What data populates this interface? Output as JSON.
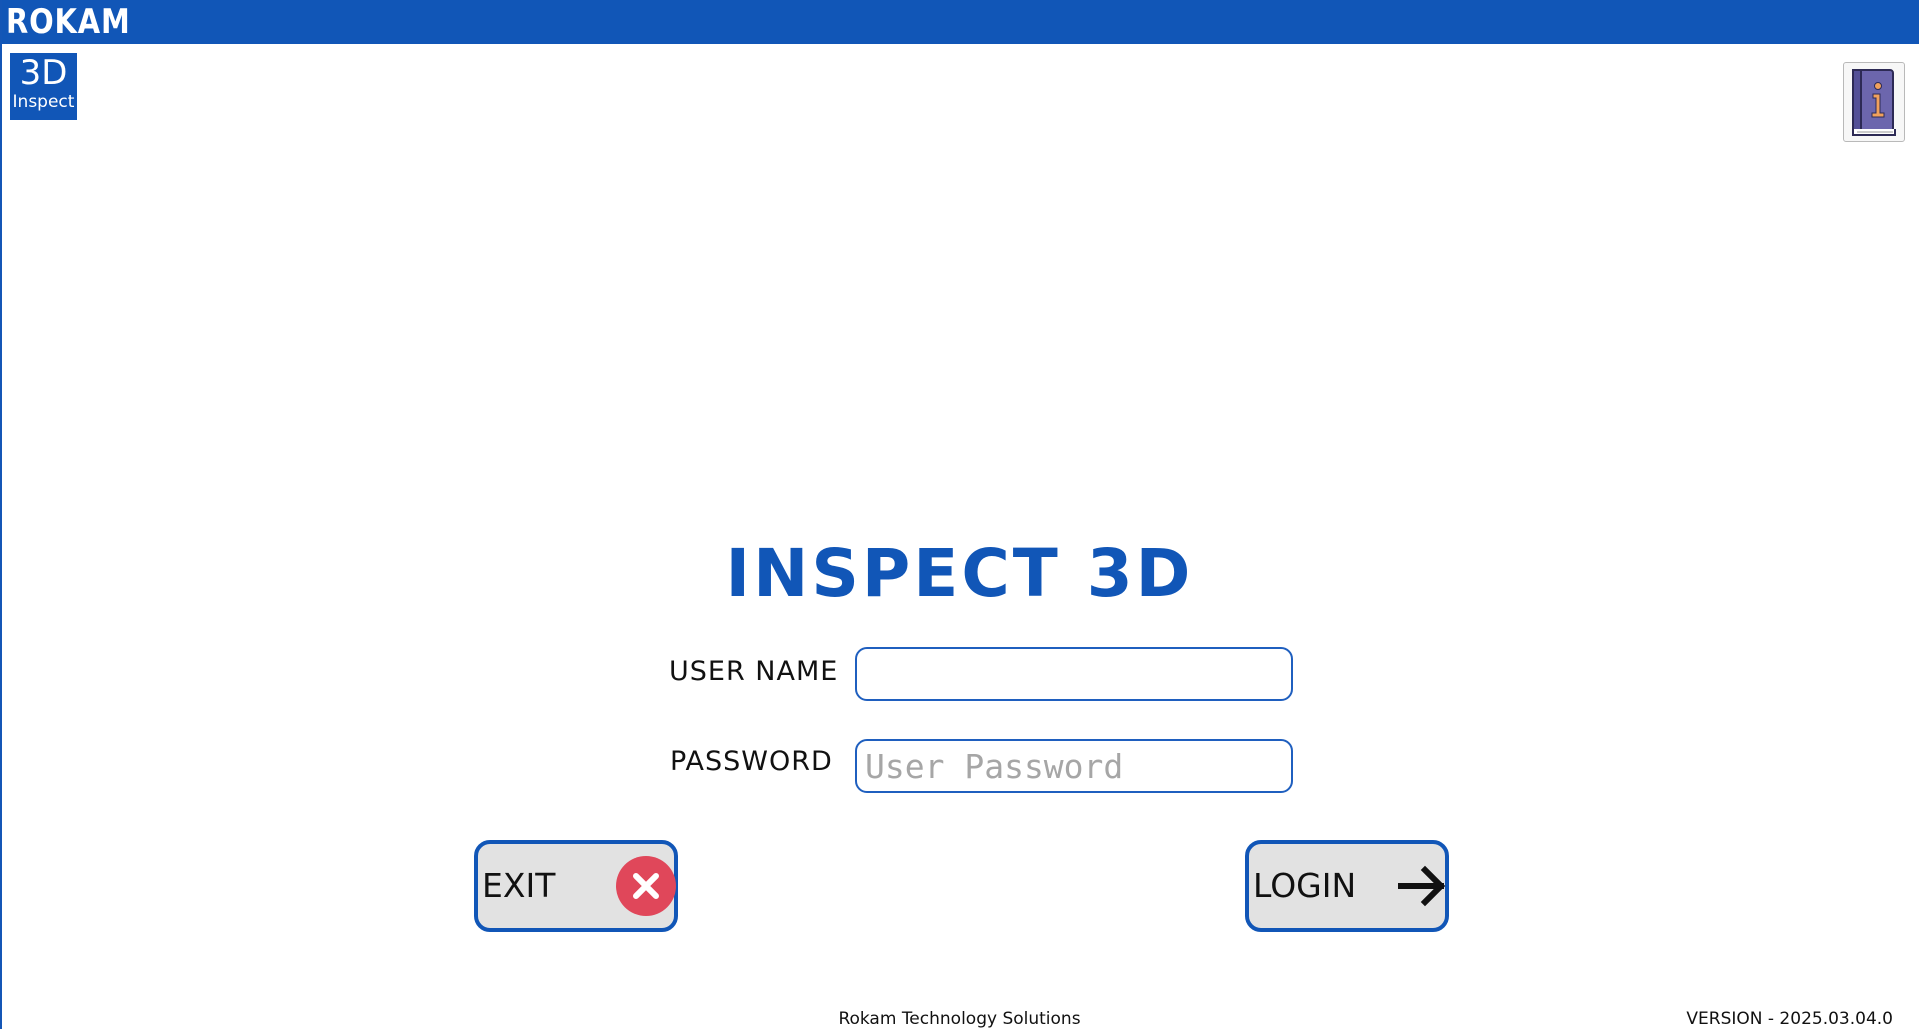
{
  "header": {
    "brand": "ROKAM"
  },
  "logo": {
    "line1": "3D",
    "line2": "Inspect"
  },
  "help": {
    "icon": "info-book-icon"
  },
  "login": {
    "title": "INSPECT 3D",
    "username_label": "USER NAME",
    "username_value": "",
    "password_label": "PASSWORD",
    "password_placeholder": "User Password"
  },
  "buttons": {
    "exit_label": "EXIT",
    "exit_icon": "close-circle-icon",
    "login_label": "LOGIN",
    "login_icon": "arrow-right-icon"
  },
  "footer": {
    "company": "Rokam Technology Solutions",
    "version": "VERSION - 2025.03.04.0"
  },
  "colors": {
    "brand_blue": "#1156b7",
    "exit_red": "#e0475a",
    "button_gray": "#e2e2e2"
  }
}
